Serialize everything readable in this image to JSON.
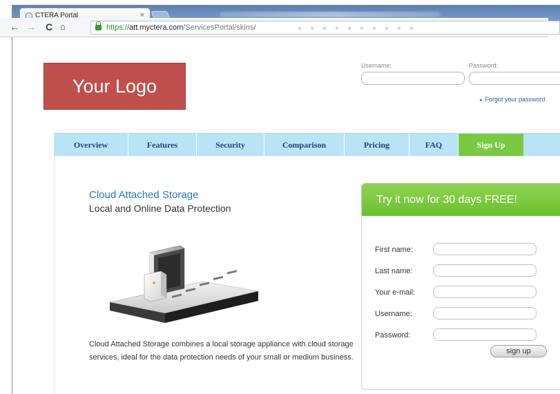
{
  "browser": {
    "tab_title": "CTERA Portal",
    "tab_close": "×",
    "url_scheme": "https://",
    "url_host": "att.myctera.com",
    "url_path": "/ServicesPortal/skins/"
  },
  "header": {
    "logo_text": "Your Logo",
    "username_label": "Username:",
    "password_label": "Password:",
    "forgot_link": "Forgot your password"
  },
  "nav": {
    "items": [
      "Overview",
      "Features",
      "Security",
      "Comparison",
      "Pricing",
      "FAQ"
    ],
    "signup": "Sign Up"
  },
  "main": {
    "headline": "Cloud Attached Storage",
    "subhead": "Local and Online Data Protection",
    "body": "Cloud Attached Storage combines a local storage appliance with cloud storage services, ideal for the data protection needs of your small or medium business."
  },
  "signup_form": {
    "title": "Try it now for 30 days FREE!",
    "fields": [
      "First name:",
      "Last name:",
      "Your e-mail:",
      "Username:",
      "Password:"
    ],
    "button": "sign up"
  },
  "colors": {
    "logo_bg": "#c0504d",
    "nav_bg": "#b9e3f7",
    "signup_green": "#7ac943",
    "headline_blue": "#2b78b8"
  }
}
